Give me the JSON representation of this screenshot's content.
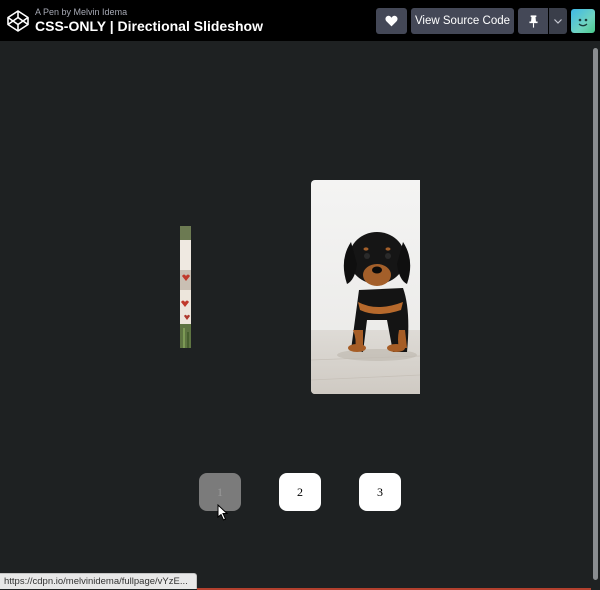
{
  "header": {
    "author_prefix": "A Pen by",
    "author_name": "Melvin Idema",
    "title": "CSS-ONLY | Directional Slideshow",
    "logo_icon": "codepen-logo-icon",
    "heart_icon": "heart-icon",
    "source_button_label": "View Source Code",
    "pin_icon": "pin-icon",
    "chevron_icon": "chevron-down-icon",
    "avatar_icon": "user-avatar"
  },
  "slideshow": {
    "slides": [
      {
        "id": 1,
        "subject": "puppy-with-hearts-fabric"
      },
      {
        "id": 2,
        "subject": "black-and-tan-dachshund-puppy"
      }
    ],
    "nav_buttons": [
      {
        "label": "1",
        "active": true
      },
      {
        "label": "2",
        "active": false
      },
      {
        "label": "3",
        "active": false
      }
    ]
  },
  "status_bar": {
    "url": "https://cdpn.io/melvinidema/fullpage/vYzE..."
  },
  "colors": {
    "topbar_bg": "#000000",
    "stage_bg": "#1e2122",
    "button_bg": "#444857",
    "active_nav_bg": "#7b7b7b"
  }
}
